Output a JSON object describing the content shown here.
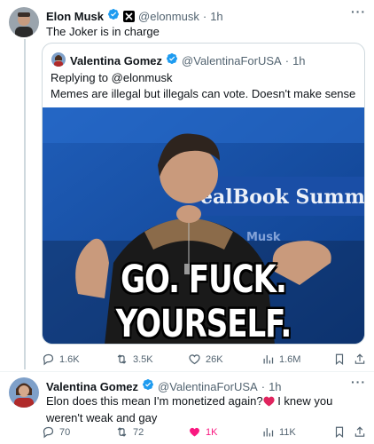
{
  "tweet": {
    "author_name": "Elon Musk",
    "author_handle": "@elonmusk",
    "time": "1h",
    "affiliation_badge": "X",
    "text": "The Joker is in charge",
    "more_icon": "more-icon",
    "quote": {
      "author_name": "Valentina Gomez",
      "author_handle": "@ValentinaForUSA",
      "time": "1h",
      "replying_to": "Replying to @elonmusk",
      "text": "Memes are illegal but illegals can vote. Doesn't make sense",
      "image_caption": "GO. FUCK. YOURSELF.",
      "background_sign": "ealBook Summit",
      "background_sign_small": "Musk"
    },
    "stats": {
      "replies": "1.6K",
      "retweets": "3.5K",
      "likes": "26K",
      "views": "1.6M"
    }
  },
  "reply": {
    "author_name": "Valentina Gomez",
    "author_handle": "@ValentinaForUSA",
    "time": "1h",
    "text_part1": "Elon does this mean I'm monetized again?",
    "text_part2": " I knew you weren't weak and gay",
    "stats": {
      "replies": "70",
      "retweets": "72",
      "likes": "1K",
      "views": "11K"
    }
  },
  "colors": {
    "verified_blue": "#1d9bf0",
    "like_pink": "#f91880",
    "secondary_text": "#536471"
  }
}
